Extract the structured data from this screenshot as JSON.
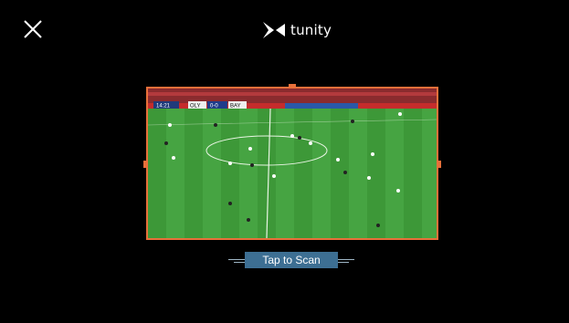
{
  "header": {
    "close_icon": "close-icon",
    "logo_text": "tunity",
    "logo_icon": "tunity-logo-icon"
  },
  "video": {
    "scoreboard": {
      "time": "14:21",
      "home_team": "OLY",
      "score": "0-0",
      "away_team": "BAY"
    }
  },
  "colors": {
    "frame_border": "#e8703a",
    "scan_button_bg": "#3d6f93",
    "pitch_green": "#3f9a3a"
  },
  "actions": {
    "scan_label": "Tap to Scan"
  }
}
